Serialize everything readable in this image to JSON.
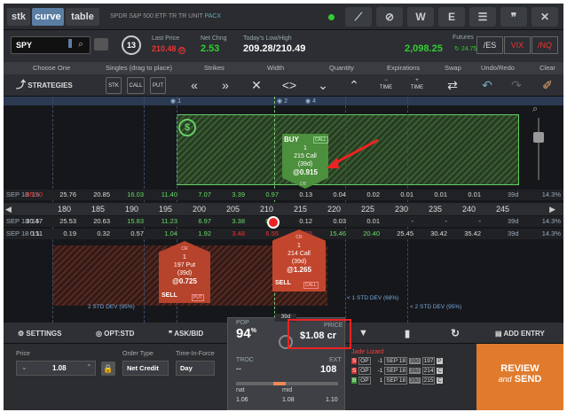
{
  "top": {
    "tabs": [
      "stk",
      "curve",
      "table"
    ],
    "symbol_desc": "SPDR S&P 500 ETF TR TR UNIT",
    "symbol_tag": "PACX",
    "icons": [
      "compass-icon",
      "link-icon",
      "W",
      "E",
      "list-icon",
      "quote-icon",
      "close-icon"
    ]
  },
  "quote": {
    "symbol": "SPY",
    "circle_num": "13",
    "last_label": "Last Price",
    "last_value": "210.48",
    "last_suffix": "D",
    "chng_label": "Net Chng",
    "chng_value": "2.53",
    "hl_label": "Today's Low/High",
    "hl_value": "209.28/210.49",
    "fut_label": "Futures",
    "fut_value": "2,098.25",
    "fut_chng": "24.75",
    "fut_btns": [
      "/ES",
      "VIX",
      "/NQ"
    ]
  },
  "header": {
    "cols": [
      "Choose One",
      "Singles (drag to place)",
      "Strikes",
      "Width",
      "Quantity",
      "Expirations",
      "Swap",
      "Undo/Redo",
      "Clear"
    ]
  },
  "toolbar": {
    "strategies": "STRATEGIES",
    "btns": [
      "STK",
      "CALL",
      "PUT"
    ],
    "time_minus": "TIME",
    "time_plus": "TIME"
  },
  "chart": {
    "marker_labels": [
      "1",
      "2",
      "4"
    ],
    "exp_label": "SEP 18 '15",
    "days": "39d",
    "iv": "14.3%",
    "call_row": [
      "30.70",
      "25.76",
      "20.85",
      "16.03",
      "11.40",
      "7.07",
      "3.39",
      "0.97",
      "0.13",
      "0.04",
      "0.02",
      "0.01",
      "0.01",
      "0.01"
    ],
    "strikes": [
      "180",
      "185",
      "190",
      "195",
      "200",
      "205",
      "210",
      "215",
      "220",
      "225",
      "230",
      "235",
      "240",
      "245"
    ],
    "call_row2": [
      "30.47",
      "25.53",
      "20.63",
      "15.83",
      "11.23",
      "6.97",
      "3.38",
      "0.91",
      "0.12",
      "0.03",
      "0.01",
      "-",
      "-",
      "-"
    ],
    "put_row": [
      "0.11",
      "0.19",
      "0.32",
      "0.57",
      "1.04",
      "1.92",
      "3.48",
      "6.55",
      "10.55",
      "15.46",
      "20.40",
      "25.45",
      "30.42",
      "35.42"
    ],
    "buy_order": {
      "side": "BUY",
      "tag": "CALL",
      "qty": "1",
      "desc": "215 Call",
      "days": "(39d)",
      "price": "@0.915",
      "db": "DB"
    },
    "sell_put": {
      "tag": "CR",
      "qty": "1",
      "desc": "197 Put",
      "days": "(39d)",
      "price": "@0.725",
      "side": "SELL",
      "type": "PUT"
    },
    "sell_call": {
      "tag": "CR",
      "qty": "1",
      "desc": "214 Call",
      "days": "(39d)",
      "price": "@1.265",
      "side": "SELL",
      "type": "CALL"
    },
    "std_left": "2 STD DEV (95%)",
    "std_mid": "< 1 STD DEV (68%)",
    "std_right": "< 2 STD DEV (95%)",
    "dollar": "$"
  },
  "bottom": {
    "settings": "SETTINGS",
    "opt": "OPT:STD",
    "askbid": "ASK/BID",
    "add_entry": "ADD ENTRY",
    "days_tab": "39d",
    "pop_label": "POP",
    "pop_value": "94",
    "pop_unit": "%",
    "price_label": "PRICE",
    "price_value": "$1.08 cr",
    "troc_label": "TROC",
    "troc_value": "--",
    "ext_label": "EXT",
    "ext_value": "108",
    "nat_label": "nat",
    "mid_label": "mid",
    "nat_low": "1.06",
    "mid_val": "1.08",
    "nat_high": "1.10",
    "price_field_label": "Price",
    "price_field_value": "1.08",
    "order_type_label": "Order Type",
    "order_type": "Net Credit",
    "tif_label": "Time-In-Force",
    "tif": "Day",
    "legs_title": "Jade Lizard",
    "legs": [
      {
        "side": "S",
        "type": "OP",
        "qty": "-1",
        "exp": "SEP 18",
        "d": "39d",
        "strike": "197",
        "pc": "P"
      },
      {
        "side": "S",
        "type": "OP",
        "qty": "-1",
        "exp": "SEP 18",
        "d": "39d",
        "strike": "214",
        "pc": "C"
      },
      {
        "side": "B",
        "type": "OP",
        "qty": "1",
        "exp": "SEP 18",
        "d": "39d",
        "strike": "215",
        "pc": "C"
      }
    ],
    "review": "REVIEW",
    "and": "and",
    "send": "SEND"
  }
}
